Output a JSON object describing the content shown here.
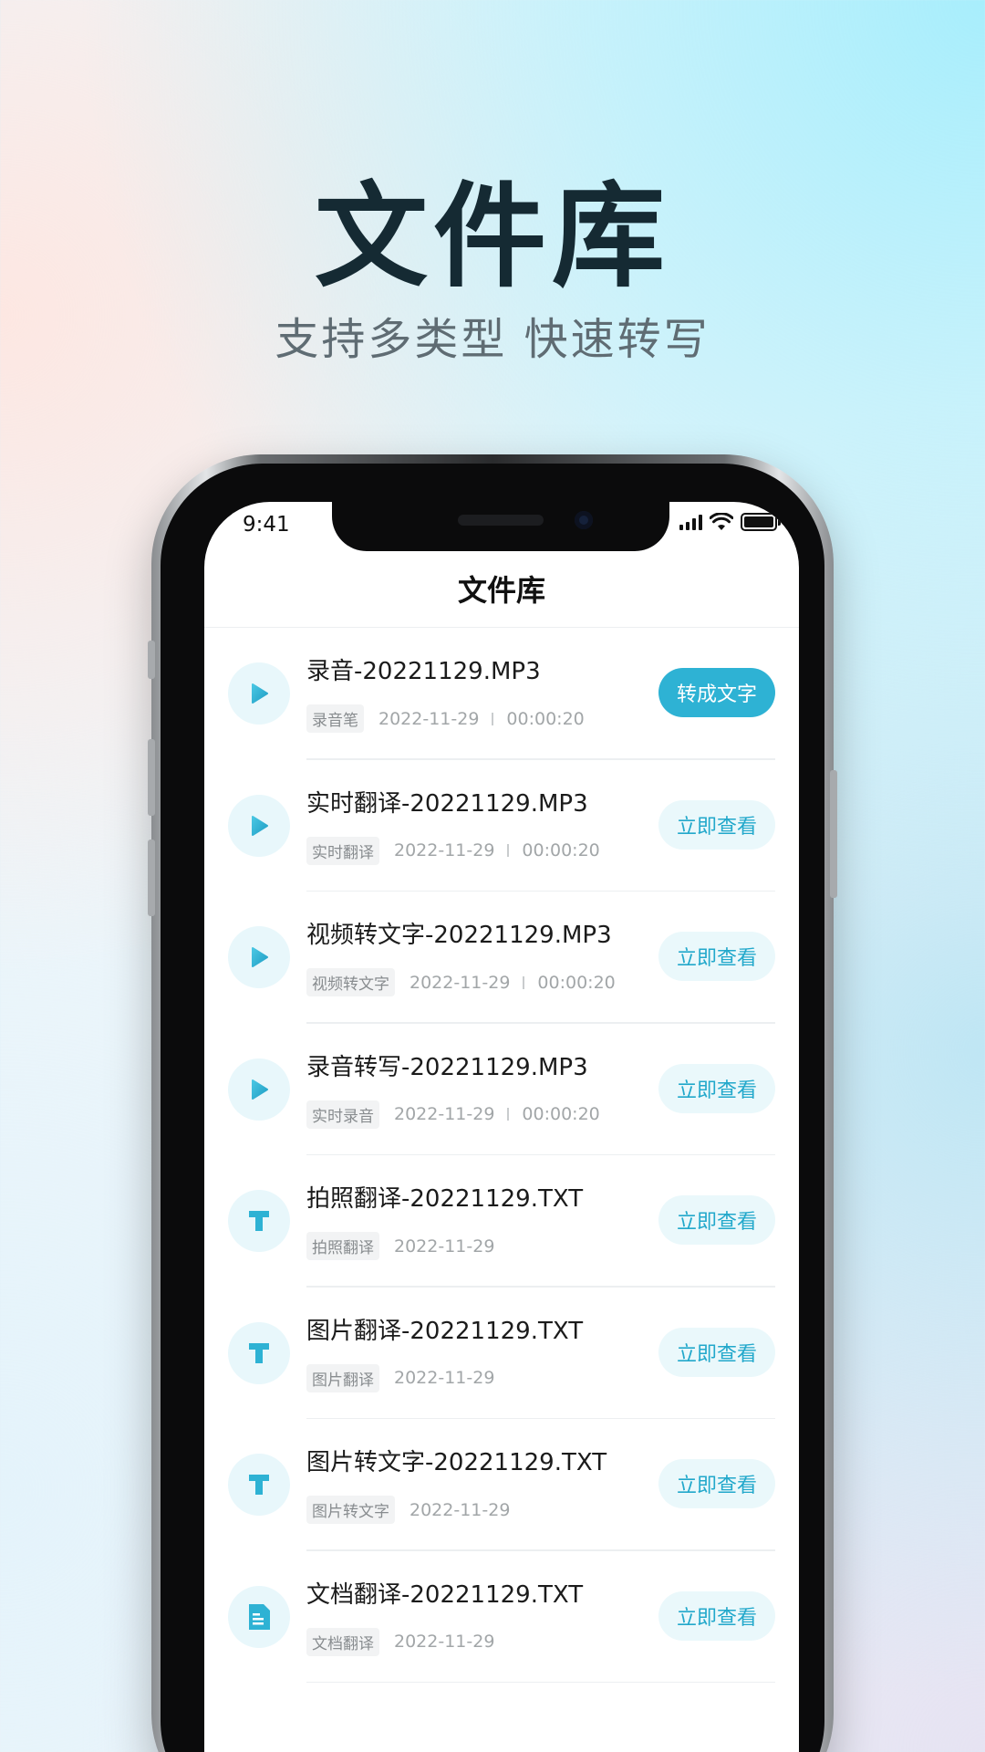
{
  "promo": {
    "title": "文件库",
    "subtitle": "支持多类型  快速转写"
  },
  "status_bar": {
    "time": "9:41"
  },
  "app": {
    "title": "文件库"
  },
  "colors": {
    "accent": "#2eb2d4",
    "accent_light": "#eaf8fb",
    "icon_bg": "#e8f7fb"
  },
  "files": [
    {
      "name": "录音-20221129.MP3",
      "tag": "录音笔",
      "date": "2022-11-29",
      "duration": "00:00:20",
      "icon": "play-icon",
      "action": "转成文字"
    },
    {
      "name": "实时翻译-20221129.MP3",
      "tag": "实时翻译",
      "date": "2022-11-29",
      "duration": "00:00:20",
      "icon": "play-icon",
      "action": "立即查看"
    },
    {
      "name": "视频转文字-20221129.MP3",
      "tag": "视频转文字",
      "date": "2022-11-29",
      "duration": "00:00:20",
      "icon": "play-icon",
      "action": "立即查看"
    },
    {
      "name": "录音转写-20221129.MP3",
      "tag": "实时录音",
      "date": "2022-11-29",
      "duration": "00:00:20",
      "icon": "play-icon",
      "action": "立即查看"
    },
    {
      "name": "拍照翻译-20221129.TXT",
      "tag": "拍照翻译",
      "date": "2022-11-29",
      "duration": "",
      "icon": "text-icon",
      "action": "立即查看"
    },
    {
      "name": "图片翻译-20221129.TXT",
      "tag": "图片翻译",
      "date": "2022-11-29",
      "duration": "",
      "icon": "text-icon",
      "action": "立即查看"
    },
    {
      "name": "图片转文字-20221129.TXT",
      "tag": "图片转文字",
      "date": "2022-11-29",
      "duration": "",
      "icon": "text-icon",
      "action": "立即查看"
    },
    {
      "name": "文档翻译-20221129.TXT",
      "tag": "文档翻译",
      "date": "2022-11-29",
      "duration": "",
      "icon": "document-icon",
      "action": "立即查看"
    }
  ]
}
